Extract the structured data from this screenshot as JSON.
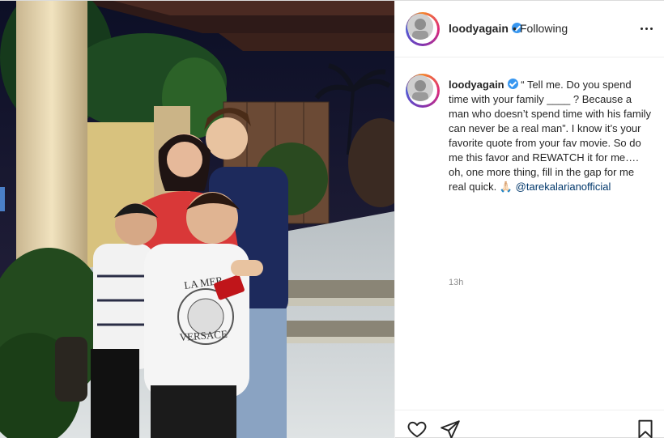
{
  "post": {
    "username": "loodyagain",
    "follow_status": "Following",
    "separator": "•",
    "caption": {
      "username": "loodyagain",
      "text": "“ Tell me. Do you spend time with your family ____ ? Because a man who doesn’t spend time with his family can never be a real man”. I know it’s your favorite quote from your fav movie. So do me this favor and REWATCH it for me…. oh, one more thing, fill in the gap for me real quick. 🙏🏻 ",
      "mention": "@tarekalarianofficial"
    },
    "timestamp": "13h",
    "photo_shirt_text": [
      "LA MER",
      "VERSACE"
    ]
  },
  "icons": {
    "verified": "verified-badge-icon",
    "more": "more-options-icon",
    "like": "heart-icon",
    "share": "paper-plane-icon",
    "save": "bookmark-icon"
  },
  "colors": {
    "verified": "#3897f0",
    "mention": "#00376b",
    "muted": "#8e8e8e",
    "text": "#262626"
  }
}
